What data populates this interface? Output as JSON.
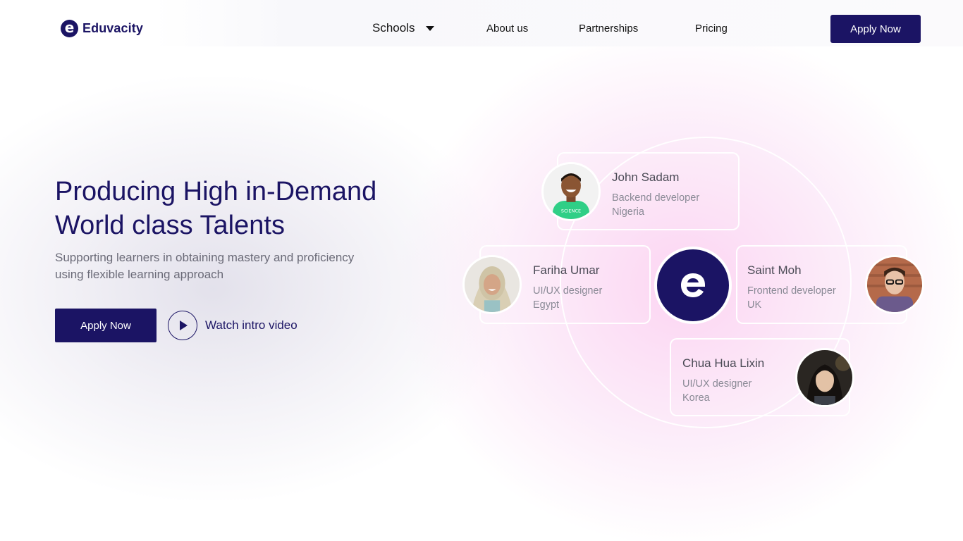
{
  "brand": {
    "name": "Eduvacity",
    "logo_letter": "e",
    "primary_color": "#1b1464"
  },
  "nav": {
    "schools": "Schools",
    "about": "About us",
    "partnerships": "Partnerships",
    "pricing": "Pricing",
    "apply": "Apply Now"
  },
  "hero": {
    "title_line1": "Producing High in-Demand",
    "title_line2": "World class Talents",
    "subtitle_line1": "Supporting learners in obtaining mastery and proficiency",
    "subtitle_line2": "using flexible learning approach",
    "apply": "Apply Now",
    "watch": "Watch intro video"
  },
  "talents": [
    {
      "name": "John Sadam",
      "role": "Backend developer",
      "country": "Nigeria"
    },
    {
      "name": "Fariha Umar",
      "role": "UI/UX designer",
      "country": "Egypt"
    },
    {
      "name": "Saint Moh",
      "role": "Frontend developer",
      "country": "UK"
    },
    {
      "name": "Chua Hua Lixin",
      "role": "UI/UX designer",
      "country": "Korea"
    }
  ]
}
